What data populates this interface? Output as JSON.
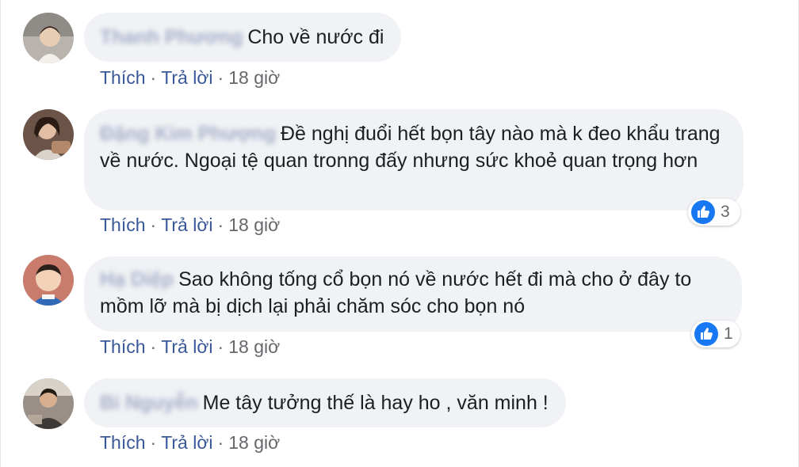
{
  "actions": {
    "like": "Thích",
    "reply": "Trả lời",
    "separator": "·"
  },
  "comments": [
    {
      "author": "Thanh Phương",
      "text": "Cho về nước đi",
      "time": "18 giờ",
      "likes": null
    },
    {
      "author": "Đặng Kim Phượng",
      "text": "Đề nghị đuổi hết bọn tây nào mà k đeo khẩu trang về nước. Ngoại tệ quan tronng đấy nhưng sức khoẻ quan trọng hơn",
      "time": "18 giờ",
      "likes": "3"
    },
    {
      "author": "Hạ Diệp",
      "text": "Sao không tống cổ bọn nó về nước hết đi mà cho ở đây to mồm lỡ mà bị dịch lại phải chăm sóc cho bọn nó",
      "time": "18 giờ",
      "likes": "1"
    },
    {
      "author": "Bi Nguyễn",
      "text": "Me tây tưởng thế là hay ho , văn minh !",
      "time": "18 giờ",
      "likes": null
    }
  ],
  "colors": {
    "bubble": "#f0f2f5",
    "link": "#385898",
    "like_blue": "#1877f2"
  },
  "icons": {
    "like": "thumbs-up-icon"
  }
}
